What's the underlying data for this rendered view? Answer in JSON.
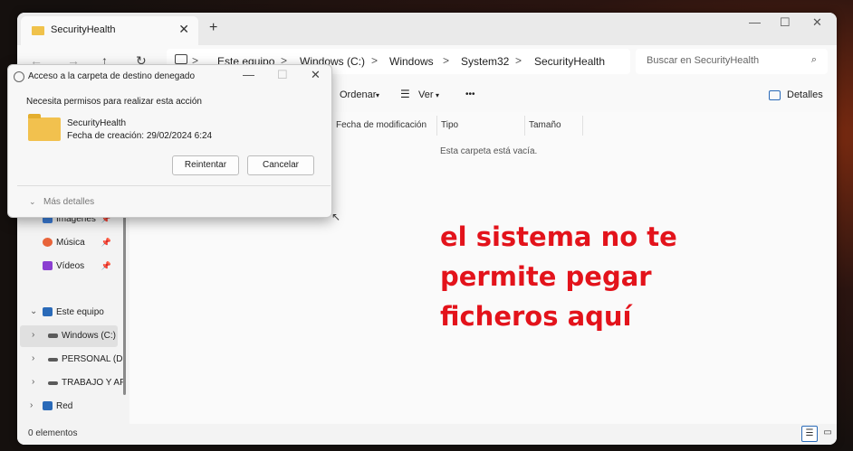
{
  "window": {
    "tab_title": "SecurityHealth",
    "tab_close": "✕",
    "new_tab": "+",
    "minimize": "—",
    "maximize": "☐",
    "close": "✕"
  },
  "address": {
    "back": "←",
    "forward": "→",
    "up": "↑",
    "refresh": "↻",
    "breadcrumbs": [
      "Este equipo",
      "Windows (C:)",
      "Windows",
      "System32",
      "SecurityHealth"
    ],
    "separator": ">",
    "search_placeholder": "Buscar en SecurityHealth",
    "search_icon": "⌕"
  },
  "toolbar": {
    "sort_label": "Ordenar",
    "view_label": "Ver",
    "more_label": "•••",
    "details_label": "Detalles"
  },
  "sidebar": {
    "quick": [
      {
        "label": "Imágenes",
        "icon": "images-icon",
        "color": "#3a7bd5"
      },
      {
        "label": "Música",
        "icon": "music-icon",
        "color": "#e8643a"
      },
      {
        "label": "Vídeos",
        "icon": "videos-icon",
        "color": "#8b3fd1"
      }
    ],
    "pc_label": "Este equipo",
    "drives": [
      {
        "label": "Windows (C:)",
        "selected": true
      },
      {
        "label": "PERSONAL (D:",
        "selected": false
      },
      {
        "label": "TRABAJO Y AP",
        "selected": false
      }
    ],
    "network_label": "Red"
  },
  "columns": [
    "Fecha de modificación",
    "Tipo",
    "Tamaño"
  ],
  "empty_text": "Esta carpeta está vacía.",
  "status": {
    "items": "0 elementos"
  },
  "overlay_text": [
    "el sistema no te",
    "permite pegar",
    "ficheros aquí"
  ],
  "dialog": {
    "title": "Acceso a la carpeta de destino denegado",
    "message": "Necesita permisos para realizar esta acción",
    "folder_name": "SecurityHealth",
    "folder_date": "Fecha de creación: 29/02/2024 6:24",
    "retry_label": "Reintentar",
    "cancel_label": "Cancelar",
    "more_details": "Más detalles",
    "minimize": "—",
    "maximize": "☐",
    "close": "✕"
  }
}
